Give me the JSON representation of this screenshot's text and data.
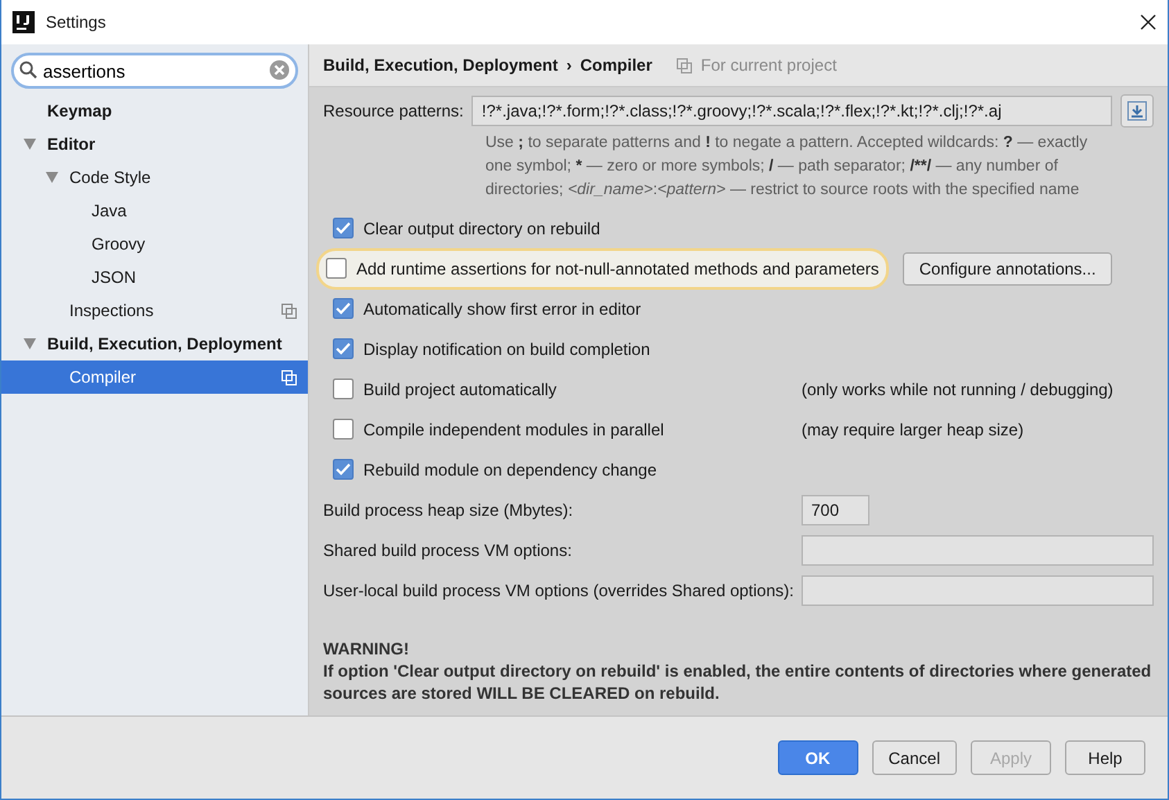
{
  "window": {
    "title": "Settings"
  },
  "search": {
    "value": "assertions"
  },
  "tree": [
    {
      "label": "Keymap",
      "selected": false,
      "project_level": false
    },
    {
      "label": "Editor",
      "selected": false,
      "expanded": true,
      "project_level": false,
      "children": [
        {
          "label": "Code Style",
          "selected": false,
          "expanded": true,
          "project_level": false,
          "children": [
            {
              "label": "Java",
              "selected": false,
              "project_level": false
            },
            {
              "label": "Groovy",
              "selected": false,
              "project_level": false
            },
            {
              "label": "JSON",
              "selected": false,
              "project_level": false
            }
          ]
        },
        {
          "label": "Inspections",
          "selected": false,
          "project_level": true
        }
      ]
    },
    {
      "label": "Build, Execution, Deployment",
      "selected": false,
      "expanded": true,
      "project_level": false,
      "children": [
        {
          "label": "Compiler",
          "selected": true,
          "project_level": true
        }
      ]
    }
  ],
  "breadcrumb": {
    "items": [
      "Build, Execution, Deployment",
      "Compiler"
    ],
    "separator": "›",
    "scope": "For current project"
  },
  "resource_patterns": {
    "label": "Resource patterns:",
    "value": "!?*.java;!?*.form;!?*.class;!?*.groovy;!?*.scala;!?*.flex;!?*.kt;!?*.clj;!?*.aj"
  },
  "help": [
    {
      "kind": "plain",
      "text": "Use "
    },
    {
      "kind": "bold",
      "text": ";"
    },
    {
      "kind": "plain",
      "text": " to separate patterns and "
    },
    {
      "kind": "bold",
      "text": "!"
    },
    {
      "kind": "plain",
      "text": " to negate a pattern. Accepted wildcards: "
    },
    {
      "kind": "bold",
      "text": "?"
    },
    {
      "kind": "plain",
      "text": " — exactly one symbol; "
    },
    {
      "kind": "bold",
      "text": "*"
    },
    {
      "kind": "plain",
      "text": " — zero or more symbols; "
    },
    {
      "kind": "bold",
      "text": "/"
    },
    {
      "kind": "plain",
      "text": " — path separator; "
    },
    {
      "kind": "bold",
      "text": "/**/"
    },
    {
      "kind": "plain",
      "text": " — any number of directories; "
    },
    {
      "kind": "italic",
      "text": "<dir_name>"
    },
    {
      "kind": "plain",
      "text": ":"
    },
    {
      "kind": "italic",
      "text": "<pattern>"
    },
    {
      "kind": "plain",
      "text": " — restrict to source roots with the specified name"
    }
  ],
  "options": [
    {
      "label": "Clear output directory on rebuild",
      "checked": true,
      "highlighted": false
    },
    {
      "label": "Add runtime assertions for not-null-annotated methods and parameters",
      "checked": false,
      "highlighted": true,
      "button": "Configure annotations..."
    },
    {
      "label": "Automatically show first error in editor",
      "checked": true,
      "highlighted": false
    },
    {
      "label": "Display notification on build completion",
      "checked": true,
      "highlighted": false
    },
    {
      "label": "Build project automatically",
      "checked": false,
      "highlighted": false,
      "note": "(only works while not running / debugging)"
    },
    {
      "label": "Compile independent modules in parallel",
      "checked": false,
      "highlighted": false,
      "note": "(may require larger heap size)"
    },
    {
      "label": "Rebuild module on dependency change",
      "checked": true,
      "highlighted": false
    }
  ],
  "fields": [
    {
      "label": "Build process heap size (Mbytes):",
      "value": "700",
      "kind": "short"
    },
    {
      "label": "Shared build process VM options:",
      "kind": "wide"
    },
    {
      "label": "User-local build process VM options (overrides Shared options):",
      "kind": "wide"
    }
  ],
  "warning": {
    "title": "WARNING!",
    "text": "If option 'Clear output directory on rebuild' is enabled, the entire contents of directories where generated sources are stored WILL BE CLEARED on rebuild."
  },
  "buttons": [
    {
      "label": "OK",
      "kind": "primary",
      "disabled": false
    },
    {
      "label": "Cancel",
      "kind": "normal",
      "disabled": false
    },
    {
      "label": "Apply",
      "kind": "normal",
      "disabled": true
    },
    {
      "label": "Help",
      "kind": "normal",
      "disabled": false
    }
  ]
}
